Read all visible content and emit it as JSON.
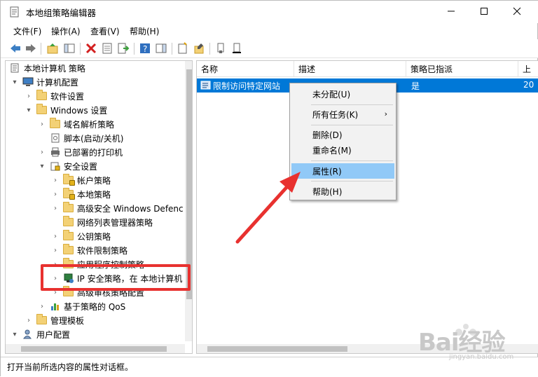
{
  "window": {
    "title": "本地组策略编辑器",
    "minimize_glyph": "—",
    "maximize_glyph": "☐",
    "close_glyph": "✕"
  },
  "menubar": {
    "items": [
      "文件(F)",
      "操作(A)",
      "查看(V)",
      "帮助(H)"
    ]
  },
  "toolbar": {
    "icons": [
      "back-icon",
      "forward-icon",
      "up-folder-icon",
      "show-hide-tree-icon",
      "delete-icon",
      "properties-icon",
      "export-list-icon",
      "help-icon",
      "show-hide-action-pane-icon",
      "new-policy-icon",
      "edit-icon",
      "assign-icon",
      "unassign-icon"
    ]
  },
  "tree": {
    "items": [
      {
        "label": "本地计算机 策略",
        "arrow": "",
        "icon": "policy-icon"
      },
      {
        "label": "计算机配置",
        "arrow": "▾",
        "icon": "computer-icon"
      },
      {
        "label": "软件设置",
        "arrow": "›",
        "icon": "folder-icon"
      },
      {
        "label": "Windows 设置",
        "arrow": "▾",
        "icon": "folder-icon"
      },
      {
        "label": "域名解析策略",
        "arrow": "›",
        "icon": "folder-icon"
      },
      {
        "label": "脚本(启动/关机)",
        "arrow": "",
        "icon": "script-icon"
      },
      {
        "label": "已部署的打印机",
        "arrow": "›",
        "icon": "printer-icon"
      },
      {
        "label": "安全设置",
        "arrow": "▾",
        "icon": "security-icon"
      },
      {
        "label": "帐户策略",
        "arrow": "›",
        "icon": "lock-folder-icon"
      },
      {
        "label": "本地策略",
        "arrow": "›",
        "icon": "lock-folder-icon"
      },
      {
        "label": "高级安全 Windows Defenc",
        "arrow": "›",
        "icon": "folder-icon"
      },
      {
        "label": "网络列表管理器策略",
        "arrow": "",
        "icon": "folder-icon"
      },
      {
        "label": "公钥策略",
        "arrow": "›",
        "icon": "folder-icon"
      },
      {
        "label": "软件限制策略",
        "arrow": "›",
        "icon": "folder-icon"
      },
      {
        "label": "应用程序控制策略",
        "arrow": "›",
        "icon": "folder-icon"
      },
      {
        "label": "IP 安全策略，在 本地计算机",
        "arrow": "›",
        "icon": "ip-security-icon"
      },
      {
        "label": "高级审核策略配置",
        "arrow": "›",
        "icon": "folder-icon"
      },
      {
        "label": "基于策略的 QoS",
        "arrow": "›",
        "icon": "qos-chart-icon"
      },
      {
        "label": "管理模板",
        "arrow": "›",
        "icon": "folder-icon"
      },
      {
        "label": "用户配置",
        "arrow": "▾",
        "icon": "user-icon"
      }
    ]
  },
  "list": {
    "columns": [
      "名称",
      "描述",
      "策略已指派",
      "上"
    ],
    "rows": [
      {
        "name": "限制访问特定网站",
        "description": "",
        "assigned": "是",
        "last": "20"
      }
    ]
  },
  "context_menu": {
    "items": [
      {
        "label": "未分配(U)",
        "submenu": ""
      },
      {
        "label": "所有任务(K)",
        "submenu": "›"
      },
      {
        "label": "删除(D)",
        "submenu": ""
      },
      {
        "label": "重命名(M)",
        "submenu": ""
      },
      {
        "label": "属性(R)",
        "submenu": ""
      },
      {
        "label": "帮助(H)",
        "submenu": ""
      }
    ],
    "highlighted": "属性(R)"
  },
  "statusbar": {
    "text": "打开当前所选内容的属性对话框。"
  },
  "watermark": {
    "text": "Bai经验",
    "sub": "jingyan.baidu.com"
  },
  "colors": {
    "selection": "#0078d7",
    "menu_highlight": "#91c9f7",
    "annotation_red": "#e8312f",
    "folder": "#f3d176"
  }
}
